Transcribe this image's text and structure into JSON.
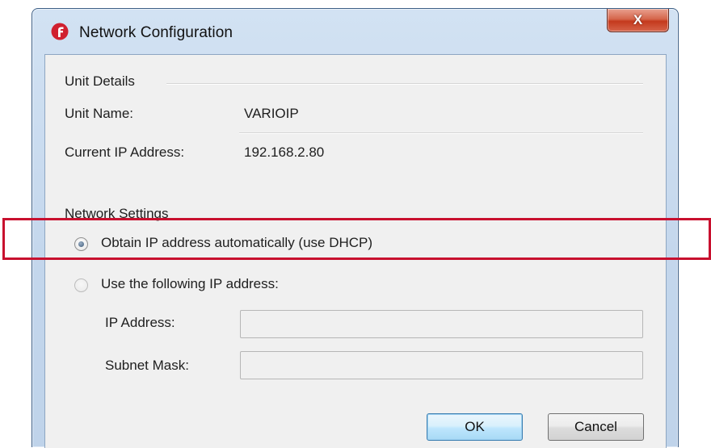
{
  "window": {
    "title": "Network Configuration",
    "close_label": "X"
  },
  "unit_details": {
    "heading": "Unit Details",
    "unit_name_label": "Unit Name:",
    "unit_name_value": "VARIOIP",
    "ip_label": "Current IP Address:",
    "ip_value": "192.168.2.80"
  },
  "network_settings": {
    "heading": "Network Settings",
    "dhcp_option": "Obtain IP address automatically (use DHCP)",
    "static_option": "Use the following IP address:",
    "selected": "dhcp",
    "ip_address_label": "IP Address:",
    "ip_address_value": "",
    "subnet_label": "Subnet Mask:",
    "subnet_value": ""
  },
  "buttons": {
    "ok": "OK",
    "cancel": "Cancel"
  },
  "colors": {
    "highlight": "#c8102e",
    "title_bar": "#c3d6ec",
    "close_button": "#c4391d"
  }
}
